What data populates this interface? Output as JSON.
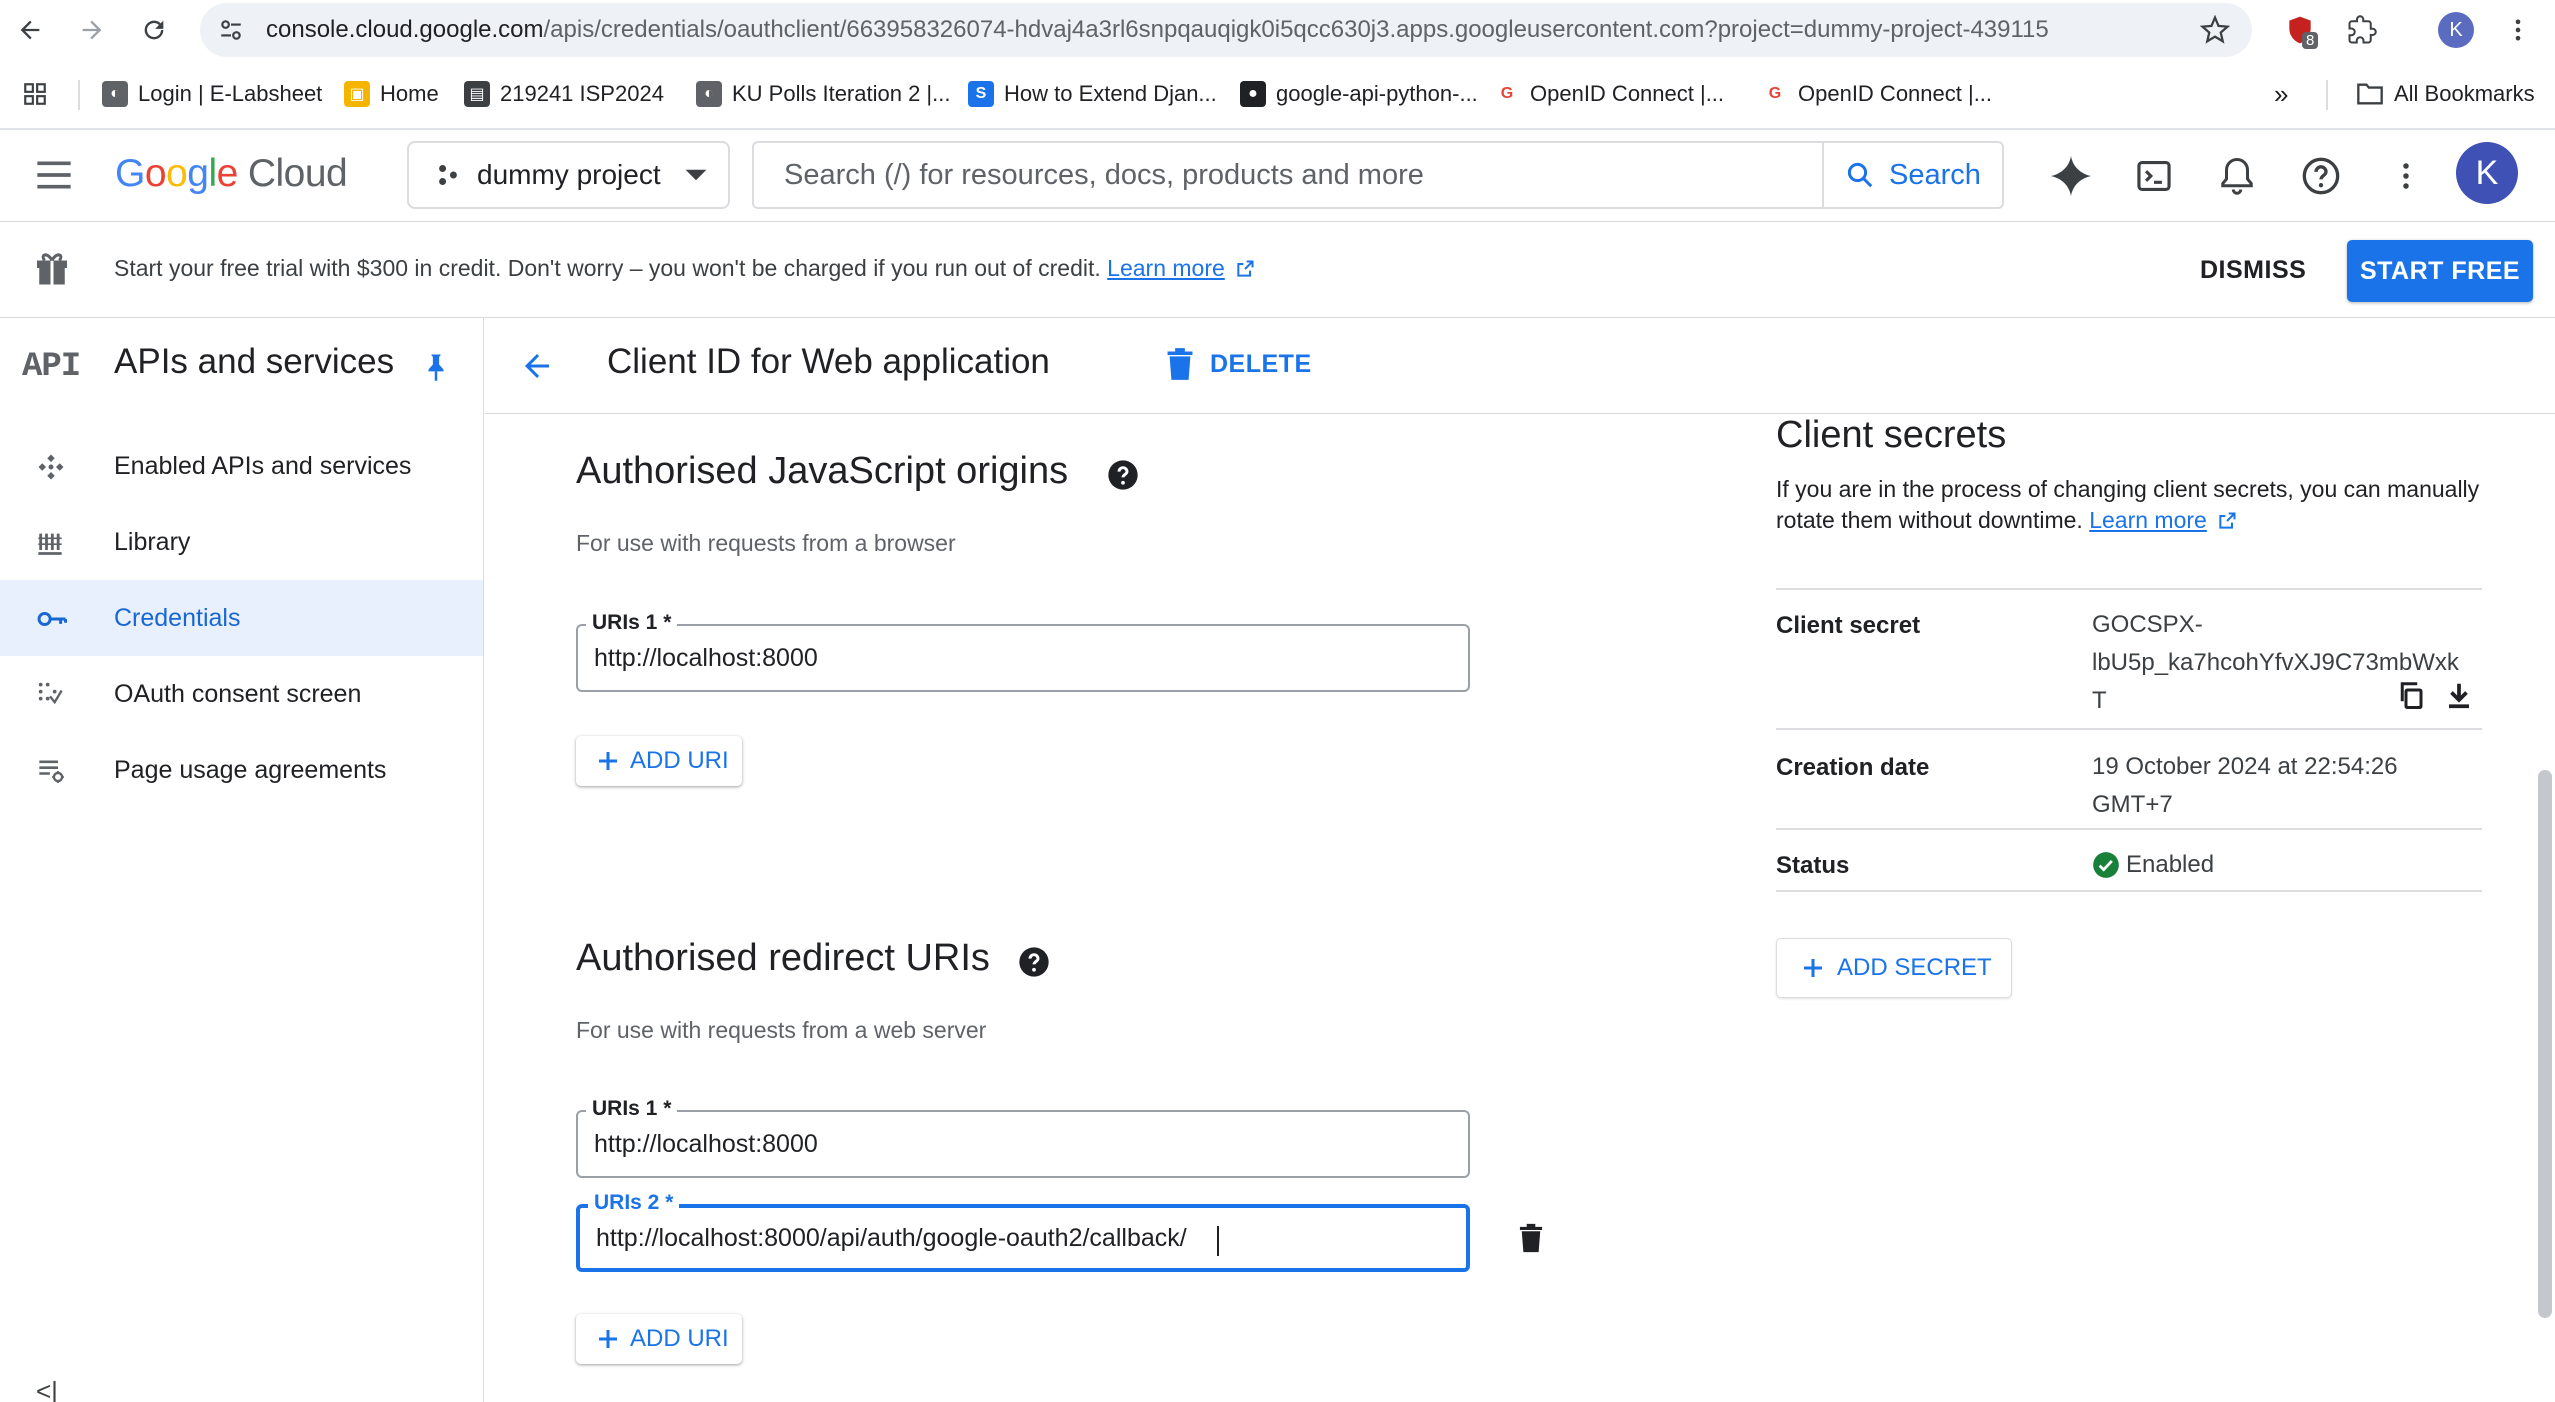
{
  "browser": {
    "url_host": "console.cloud.google.com",
    "url_path": "/apis/credentials/oauthclient/663958326074-hdvaj4a3rl6snpqauqigk0i5qcc630j3.apps.googleusercontent.com?project=dummy-project-439115",
    "extension_badge": "8",
    "profile_initial": "K",
    "bookmarks": [
      {
        "label": "Login | E-Labsheet",
        "color": "#5f6368",
        "glyph": "◐"
      },
      {
        "label": "Home",
        "color": "#f4b400",
        "glyph": "▣"
      },
      {
        "label": "219241 ISP2024",
        "color": "#3c4043",
        "glyph": "▤"
      },
      {
        "label": "KU Polls Iteration 2 |...",
        "color": "#5f6368",
        "glyph": "◐"
      },
      {
        "label": "How to Extend Djan...",
        "color": "#1a73e8",
        "glyph": "S"
      },
      {
        "label": "google-api-python-...",
        "color": "#202124",
        "glyph": "●"
      },
      {
        "label": "OpenID Connect  |...",
        "color": "#ea4335",
        "glyph": "G"
      },
      {
        "label": "OpenID Connect  |...",
        "color": "#ea4335",
        "glyph": "G"
      }
    ],
    "bookmarks_overflow": "»",
    "all_bookmarks": "All Bookmarks"
  },
  "header": {
    "logo_google": "Google",
    "logo_cloud": "Cloud",
    "project_name": "dummy project",
    "search_placeholder": "Search (/) for resources, docs, products and more",
    "search_button": "Search",
    "avatar_initial": "K"
  },
  "banner": {
    "message": "Start your free trial with $300 in credit. Don't worry – you won't be charged if you run out of credit. ",
    "learn_more": "Learn more",
    "dismiss": "DISMISS",
    "start_free": "START FREE"
  },
  "sidenav": {
    "badge": "API",
    "title": "APIs and services",
    "items": [
      {
        "label": "Enabled APIs and services",
        "icon": "enabled-apis-icon"
      },
      {
        "label": "Library",
        "icon": "library-icon"
      },
      {
        "label": "Credentials",
        "icon": "key-icon",
        "active": true
      },
      {
        "label": "OAuth consent screen",
        "icon": "consent-icon"
      },
      {
        "label": "Page usage agreements",
        "icon": "agreements-icon"
      }
    ],
    "collapse": "<|"
  },
  "page": {
    "title": "Client ID for Web application",
    "delete_label": "DELETE"
  },
  "js_origins": {
    "title": "Authorised JavaScript origins",
    "subtitle": "For use with requests from a browser",
    "uris": [
      {
        "label": "URIs 1 *",
        "value": "http://localhost:8000"
      }
    ],
    "add_label": "ADD URI"
  },
  "redirect_uris": {
    "title": "Authorised redirect URIs",
    "subtitle": "For use with requests from a web server",
    "uris": [
      {
        "label": "URIs 1 *",
        "value": "http://localhost:8000"
      },
      {
        "label": "URIs 2 *",
        "value": "http://localhost:8000/api/auth/google-oauth2/callback/",
        "focused": true
      }
    ],
    "add_label": "ADD URI"
  },
  "secrets": {
    "title": "Client secrets",
    "description": "If you are in the process of changing client secrets, you can manually rotate them without downtime. ",
    "learn_more": "Learn more",
    "rows": [
      {
        "key": "Client secret",
        "value_lines": [
          "GOCSPX-",
          "lbU5p_ka7hcohYfvXJ9C73mbWxk",
          "T"
        ]
      },
      {
        "key": "Creation date",
        "value_lines": [
          "19 October 2024 at 22:54:26",
          "GMT+7"
        ]
      },
      {
        "key": "Status",
        "value": "Enabled"
      }
    ],
    "add_secret": "ADD SECRET"
  },
  "colors": {
    "accent": "#1a73e8",
    "active_nav_bg": "#e8f0fe",
    "status_enabled": "#188038"
  }
}
